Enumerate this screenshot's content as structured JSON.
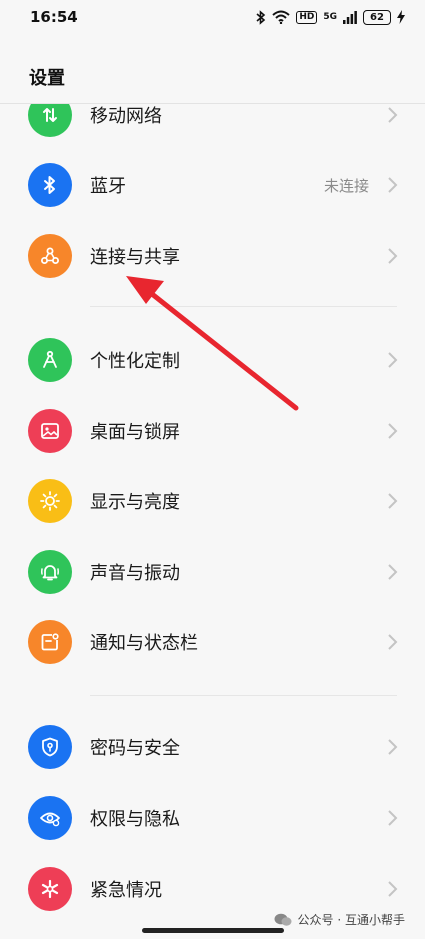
{
  "status_bar": {
    "time": "16:54",
    "hd": "HD",
    "network": "5G",
    "battery": "62"
  },
  "header": {
    "title": "设置"
  },
  "items": [
    {
      "label": "移动网络",
      "value": "",
      "icon": "mobile-data-icon",
      "color": "#2fc45a"
    },
    {
      "label": "蓝牙",
      "value": "未连接",
      "icon": "bluetooth-icon",
      "color": "#1a73f2"
    },
    {
      "label": "连接与共享",
      "value": "",
      "icon": "share-connection-icon",
      "color": "#f7862a"
    },
    {
      "label": "个性化定制",
      "value": "",
      "icon": "compass-icon",
      "color": "#2fc45a"
    },
    {
      "label": "桌面与锁屏",
      "value": "",
      "icon": "picture-icon",
      "color": "#ee3e56"
    },
    {
      "label": "显示与亮度",
      "value": "",
      "icon": "sun-icon",
      "color": "#f9be16"
    },
    {
      "label": "声音与振动",
      "value": "",
      "icon": "bell-icon",
      "color": "#2fc45a"
    },
    {
      "label": "通知与状态栏",
      "value": "",
      "icon": "notification-icon",
      "color": "#f7862a"
    },
    {
      "label": "密码与安全",
      "value": "",
      "icon": "shield-icon",
      "color": "#1a73f2"
    },
    {
      "label": "权限与隐私",
      "value": "",
      "icon": "privacy-eye-icon",
      "color": "#1a73f2"
    },
    {
      "label": "紧急情况",
      "value": "",
      "icon": "emergency-icon",
      "color": "#ee3e56"
    }
  ],
  "watermark": {
    "text": "公众号 · 互通小帮手"
  }
}
